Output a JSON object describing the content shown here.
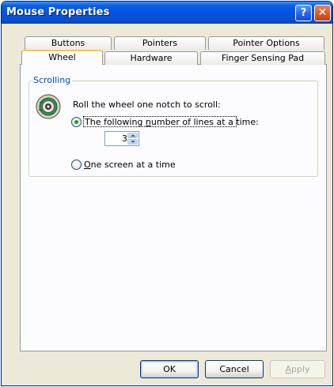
{
  "window": {
    "title": "Mouse Properties"
  },
  "title_buttons": {
    "help_glyph": "?",
    "close_glyph": "✕"
  },
  "tabs": {
    "row1": [
      {
        "label": "Buttons"
      },
      {
        "label": "Pointers"
      },
      {
        "label": "Pointer Options"
      }
    ],
    "row2": [
      {
        "label": "Wheel",
        "active": true
      },
      {
        "label": "Hardware"
      },
      {
        "label": "Finger Sensing Pad"
      }
    ]
  },
  "scrolling": {
    "group_label": "Scrolling",
    "icon": "mouse-wheel-icon",
    "description": "Roll the wheel one notch to scroll:",
    "option_lines": {
      "label_prefix": "The following ",
      "label_underlined": "n",
      "label_suffix": "umber of lines at a time:",
      "selected": true
    },
    "lines_value": "3",
    "option_screen": {
      "label_underlined": "O",
      "label_suffix": "ne screen at a time",
      "selected": false
    }
  },
  "buttons": {
    "ok": "OK",
    "cancel": "Cancel",
    "apply_underlined": "A",
    "apply_suffix": "pply"
  },
  "colors": {
    "title_bar": "#0054e3",
    "active_tab_accent": "#ffc83c",
    "group_label": "#0046d5",
    "radio_dot": "#21a121"
  }
}
